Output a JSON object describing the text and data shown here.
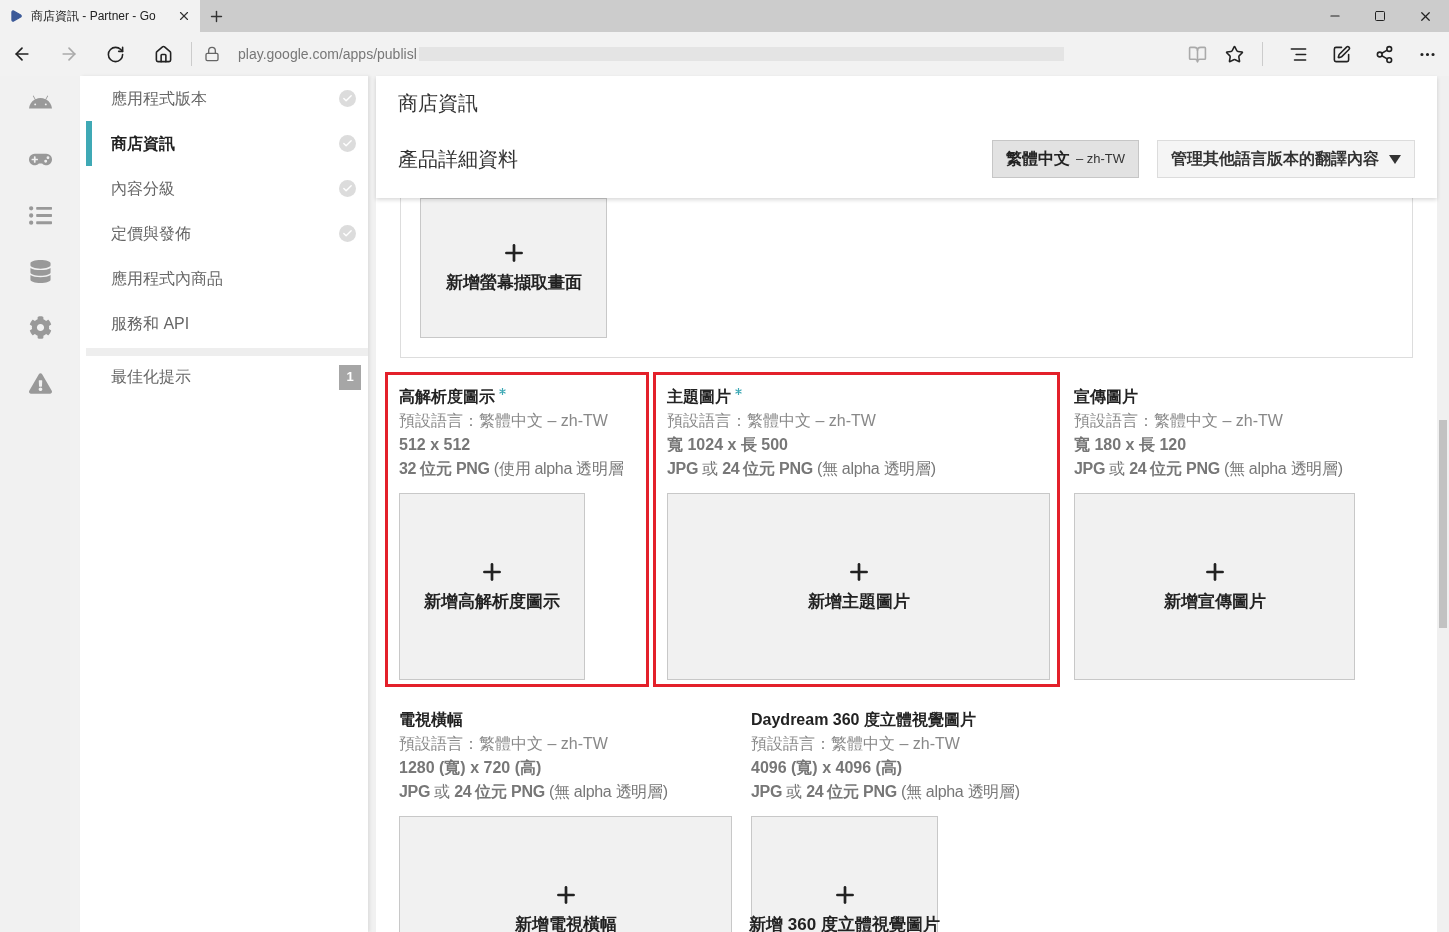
{
  "browser": {
    "tab_title": "商店資訊 - Partner - Go",
    "url": "play.google.com/apps/publisl"
  },
  "sidebar": {
    "items": [
      {
        "label": "應用程式版本",
        "selected": false,
        "complete": true
      },
      {
        "label": "商店資訊",
        "selected": true,
        "complete": true
      },
      {
        "label": "內容分級",
        "selected": false,
        "complete": true
      },
      {
        "label": "定價與發佈",
        "selected": false,
        "complete": true
      },
      {
        "label": "應用程式內商品",
        "selected": false,
        "complete": false
      },
      {
        "label": "服務和 API",
        "selected": false,
        "complete": false
      }
    ],
    "tips": {
      "label": "最佳化提示",
      "count": "1"
    }
  },
  "header": {
    "title": "商店資訊",
    "subtitle": "產品詳細資料",
    "language_button": {
      "label": "繁體中文",
      "code": "– zh-TW"
    },
    "translations_button": "管理其他語言版本的翻譯內容"
  },
  "screenshot_tile": {
    "add_label": "新增螢幕擷取畫面"
  },
  "graphics": [
    {
      "kind": "icon",
      "title": "高解析度圖示",
      "required": true,
      "highlighted": true,
      "language": "預設語言：繁體中文 – zh-TW",
      "size": "512 x 512",
      "format": "**32 位元 PNG** (使用 alpha 透明層",
      "add_label": "新增高解析度圖示"
    },
    {
      "kind": "feature",
      "title": "主題圖片",
      "required": true,
      "highlighted": true,
      "language": "預設語言：繁體中文 – zh-TW",
      "size": "寬 1024 x 長 500",
      "format": "**JPG** 或 **24 位元 PNG** (無 alpha 透明層)",
      "add_label": "新增主題圖片"
    },
    {
      "kind": "promo",
      "title": "宣傳圖片",
      "required": false,
      "highlighted": false,
      "language": "預設語言：繁體中文 – zh-TW",
      "size": "寬 180 x 長 120",
      "format": "**JPG** 或 **24 位元 PNG** (無 alpha 透明層)",
      "add_label": "新增宣傳圖片"
    },
    {
      "kind": "tv",
      "title": "電視橫幅",
      "required": false,
      "highlighted": false,
      "language": "預設語言：繁體中文 – zh-TW",
      "size": "1280 (寬) x 720 (高)",
      "format": "**JPG** 或 **24 位元 PNG** (無 alpha 透明層)",
      "add_label": "新增電視橫幅"
    },
    {
      "kind": "daydream",
      "title": "Daydream 360 度立體視覺圖片",
      "required": false,
      "highlighted": false,
      "language": "預設語言：繁體中文 – zh-TW",
      "size": "4096 (寬) x 4096 (高)",
      "format": "**JPG** 或 **24 位元 PNG** (無 alpha 透明層)",
      "add_label": "新增 360 度立體視覺圖片"
    }
  ]
}
